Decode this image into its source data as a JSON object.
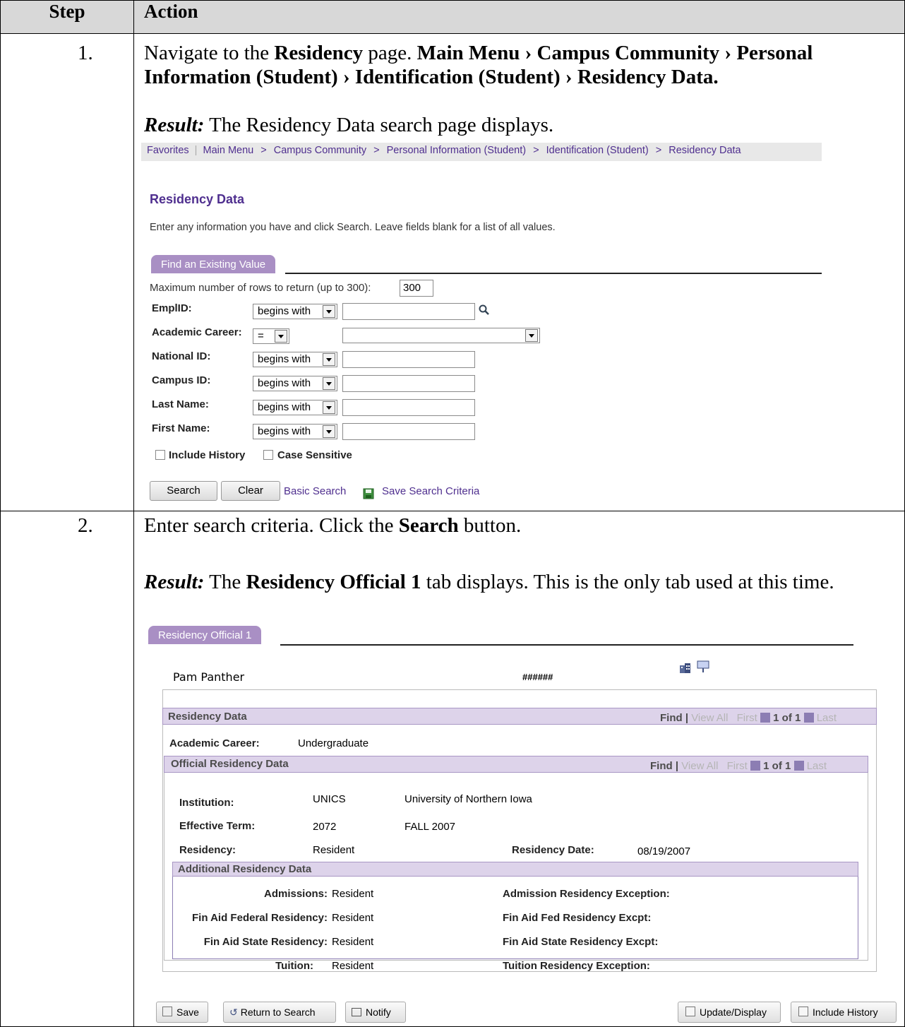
{
  "table": {
    "col_step": "Step",
    "col_action": "Action"
  },
  "step1": {
    "number": "1.",
    "text_pre": "Navigate to the ",
    "text_bold1": "Residency",
    "text_mid": " page.  ",
    "text_path": "Main Menu › Campus Community › Personal Information (Student) › Identification (Student) › Residency Data.",
    "result_label": "Result:",
    "result_text": "  The Residency Data search page displays."
  },
  "breadcrumb": {
    "items": [
      "Favorites",
      "Main Menu",
      "Campus Community",
      "Personal Information (Student)",
      "Identification (Student)",
      "Residency Data"
    ],
    "sep": ">"
  },
  "search_page": {
    "title": "Residency Data",
    "instructions": "Enter any information you have and click Search. Leave fields blank for a list of all values.",
    "tab": "Find an Existing Value",
    "max_rows_label": "Maximum number of rows to return (up to 300):",
    "max_rows_value": "300",
    "fields": [
      {
        "label": "EmplID:",
        "op": "begins with"
      },
      {
        "label": "Academic Career:",
        "op": "="
      },
      {
        "label": "National ID:",
        "op": "begins with"
      },
      {
        "label": "Campus ID:",
        "op": "begins with"
      },
      {
        "label": "Last Name:",
        "op": "begins with"
      },
      {
        "label": "First Name:",
        "op": "begins with"
      }
    ],
    "include_history": "Include History",
    "case_sensitive": "Case Sensitive",
    "search_btn": "Search",
    "clear_btn": "Clear",
    "basic_search": "Basic Search",
    "save_criteria": "Save Search Criteria"
  },
  "step2": {
    "number": "2.",
    "text_pre": "Enter search criteria.  Click the ",
    "text_bold": "Search",
    "text_post": " button.",
    "result_label": "Result:",
    "result_pre": " The ",
    "result_bold": "Residency Official 1",
    "result_post": " tab displays.  This is the only tab used at this time."
  },
  "residency_page": {
    "tab": "Residency Official 1",
    "name": "Pam Panther",
    "id": "######",
    "grid_title": "Residency Data",
    "nav": {
      "find": "Find",
      "view_all": "View All",
      "first": "First",
      "count": "1 of 1",
      "last": "Last",
      "sep": "|"
    },
    "academic_career_label": "Academic Career:",
    "academic_career_value": "Undergraduate",
    "official_title": "Official Residency Data",
    "institution_label": "Institution:",
    "institution_code": "UNICS",
    "institution_name": "University of Northern Iowa",
    "term_label": "Effective Term:",
    "term_code": "2072",
    "term_name": "FALL 2007",
    "residency_label": "Residency:",
    "residency_value": "Resident",
    "residency_date_label": "Residency Date:",
    "residency_date_value": "08/19/2007",
    "additional_title": "Additional Residency Data",
    "additional": [
      {
        "label": "Admissions:",
        "value": "Resident",
        "exc_label": "Admission Residency Exception:"
      },
      {
        "label": "Fin Aid Federal Residency:",
        "value": "Resident",
        "exc_label": "Fin Aid Fed Residency Excpt:"
      },
      {
        "label": "Fin Aid State Residency:",
        "value": "Resident",
        "exc_label": "Fin Aid State Residency Excpt:"
      },
      {
        "label": "Tuition:",
        "value": "Resident",
        "exc_label": "Tuition Residency Exception:"
      }
    ],
    "footer": {
      "save": "Save",
      "return": "Return to Search",
      "notify": "Notify",
      "update": "Update/Display",
      "include_history": "Include History"
    }
  }
}
